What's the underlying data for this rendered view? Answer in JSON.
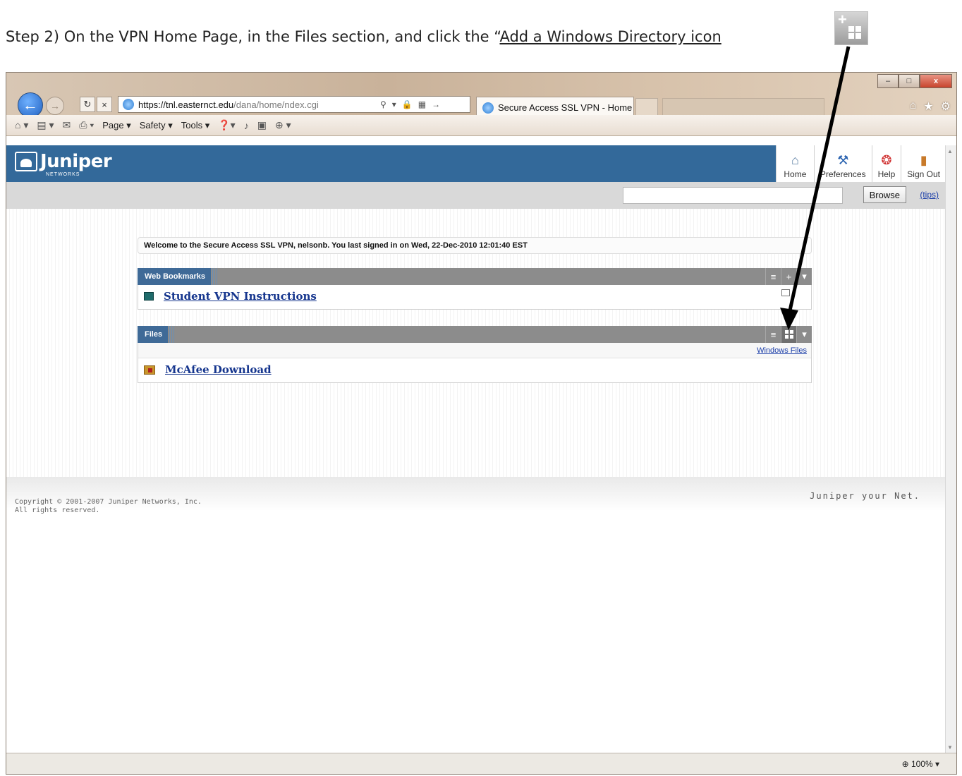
{
  "instruction": {
    "prefix": "Step 2) On the VPN Home Page, in the Files section, and click the “",
    "link": "Add a Windows Directory icon"
  },
  "browser": {
    "url_host": "https://tnl.easternct.edu",
    "url_path": "/dana/home/ndex.cgi",
    "tab_title": "Secure Access SSL VPN - Home",
    "command_bar": [
      "Page ▾",
      "Safety ▾",
      "Tools ▾"
    ],
    "zoom": "⊕ 100%   ▾"
  },
  "juniper": {
    "brand": "Juniper",
    "brand_sub": "NETWORKS",
    "nav": {
      "home": "Home",
      "preferences": "Preferences",
      "help": "Help",
      "signout": "Sign Out"
    },
    "browse": "Browse",
    "tips": "(tips)",
    "welcome": "Welcome to the Secure Access SSL VPN, nelsonb.  You last signed in on  Wed, 22-Dec-2010 12:01:40 EST",
    "bookmarks": {
      "title": "Web Bookmarks",
      "items": [
        "Student VPN Instructions"
      ]
    },
    "files": {
      "title": "Files",
      "sublink": "Windows Files",
      "items": [
        "McAfee Download"
      ]
    },
    "copyright": [
      "Copyright © 2001-2007 Juniper Networks, Inc.",
      "All rights reserved."
    ],
    "tagline": "Juniper your Net."
  },
  "colors": {
    "header": "#33699a",
    "panel_label": "#3f6a97",
    "link": "#16368e"
  }
}
